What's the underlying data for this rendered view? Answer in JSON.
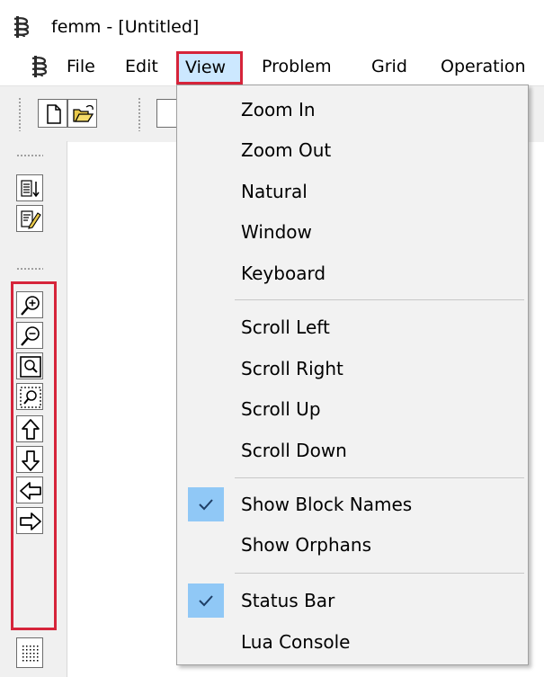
{
  "window": {
    "title": "femm - [Untitled]"
  },
  "menubar": {
    "items": [
      "File",
      "Edit",
      "View",
      "Problem",
      "Grid",
      "Operation"
    ],
    "active": "View"
  },
  "toolbar": {
    "buttons": [
      "new-file-icon",
      "open-folder-icon"
    ]
  },
  "sidebar": {
    "buttons": [
      "list-sort-icon",
      "edit-properties-icon",
      "zoom-in-icon",
      "zoom-out-icon",
      "zoom-natural-icon",
      "zoom-window-icon",
      "scroll-up-icon",
      "scroll-down-icon",
      "scroll-left-icon",
      "scroll-right-icon",
      "grid-icon"
    ]
  },
  "view_menu": {
    "items": [
      {
        "label": "Zoom In",
        "checked": false
      },
      {
        "label": "Zoom Out",
        "checked": false
      },
      {
        "label": "Natural",
        "checked": false
      },
      {
        "label": "Window",
        "checked": false
      },
      {
        "label": "Keyboard",
        "checked": false
      },
      {
        "label": "Scroll Left",
        "checked": false
      },
      {
        "label": "Scroll Right",
        "checked": false
      },
      {
        "label": "Scroll Up",
        "checked": false
      },
      {
        "label": "Scroll Down",
        "checked": false
      },
      {
        "label": "Show Block Names",
        "checked": true
      },
      {
        "label": "Show Orphans",
        "checked": false
      },
      {
        "label": "Status Bar",
        "checked": true
      },
      {
        "label": "Lua Console",
        "checked": false
      }
    ]
  },
  "colors": {
    "highlight_border": "#d6243a",
    "check_background": "#90c8f6",
    "menu_background": "#f2f2f2"
  }
}
